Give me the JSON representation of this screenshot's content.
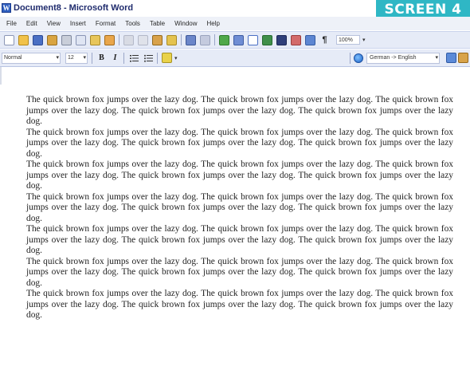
{
  "window": {
    "title": "Document8 - Microsoft Word"
  },
  "badge": {
    "label": "SCREEN 4",
    "color": "#2fb7c5"
  },
  "menu": {
    "items": [
      "File",
      "Edit",
      "View",
      "Insert",
      "Format",
      "Tools",
      "Table",
      "Window",
      "Help"
    ]
  },
  "toolbar": {
    "zoom": "100%",
    "buttons": [
      "new-document-icon",
      "open-icon",
      "save-icon",
      "permission-icon",
      "print-icon",
      "print-preview-icon",
      "spelling-icon",
      "research-icon",
      "cut-icon",
      "copy-icon",
      "paste-icon",
      "format-painter-icon",
      "undo-icon",
      "redo-icon",
      "hyperlink-icon",
      "tables-borders-icon",
      "insert-table-icon",
      "insert-excel-icon",
      "columns-icon",
      "drawing-icon",
      "document-map-icon",
      "show-formatting-icon"
    ]
  },
  "formatting": {
    "style": "Normal",
    "font_size": "12",
    "bold": "B",
    "italic": "I",
    "translate": "German -> English"
  },
  "document": {
    "paragraphs": [
      "The quick brown fox jumps over the lazy dog.  The quick brown fox jumps over the lazy dog.  The quick brown fox jumps over the lazy dog.  The quick brown fox jumps over the lazy dog.  The quick brown fox jumps over the lazy dog.",
      "The quick brown fox jumps over the lazy dog.  The quick brown fox jumps over the lazy dog.  The quick brown fox jumps over the lazy dog.  The quick brown fox jumps over the lazy dog.  The quick brown fox jumps over the lazy dog.",
      "The quick brown fox jumps over the lazy dog.  The quick brown fox jumps over the lazy dog.  The quick brown fox jumps over the lazy dog.  The quick brown fox jumps over the lazy dog.  The quick brown fox jumps over the lazy dog.",
      "The quick brown fox jumps over the lazy dog.  The quick brown fox jumps over the lazy dog.  The quick brown fox jumps over the lazy dog.  The quick brown fox jumps over the lazy dog.  The quick brown fox jumps over the lazy dog.",
      "The quick brown fox jumps over the lazy dog.  The quick brown fox jumps over the lazy dog.  The quick brown fox jumps over the lazy dog.  The quick brown fox jumps over the lazy dog.  The quick brown fox jumps over the lazy dog.",
      "The quick brown fox jumps over the lazy dog.  The quick brown fox jumps over the lazy dog.  The quick brown fox jumps over the lazy dog.  The quick brown fox jumps over the lazy dog.  The quick brown fox jumps over the lazy dog.",
      "The quick brown fox jumps over the lazy dog.  The quick brown fox jumps over the lazy dog.  The quick brown fox jumps over the lazy dog.  The quick brown fox jumps over the lazy dog.  The quick brown fox jumps over the lazy dog."
    ]
  }
}
